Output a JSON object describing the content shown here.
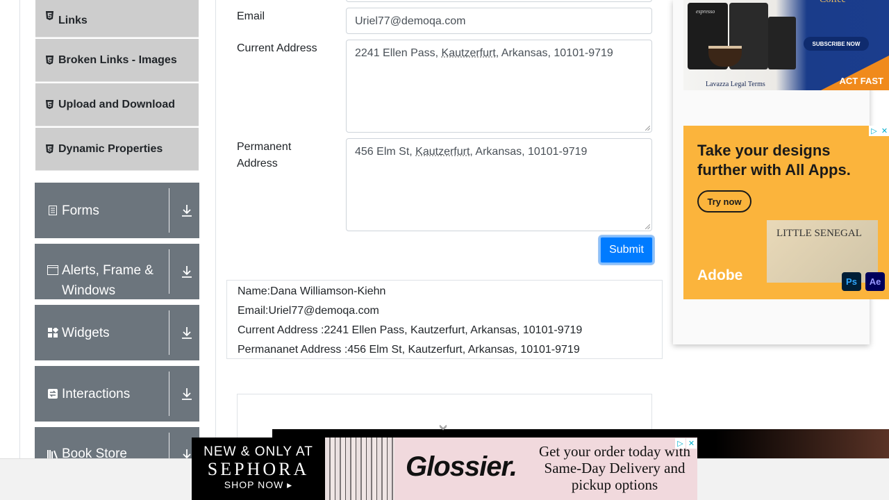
{
  "sidebar": {
    "sub_items": [
      {
        "label": "Links",
        "icon": "html5-icon"
      },
      {
        "label": "Broken Links - Images",
        "icon": "html5-icon"
      },
      {
        "label": "Upload and Download",
        "icon": "html5-icon"
      },
      {
        "label": "Dynamic Properties",
        "icon": "html5-icon"
      }
    ],
    "groups": [
      {
        "label": "Forms",
        "icon": "document-icon"
      },
      {
        "label": "Alerts, Frame & Windows",
        "icon": "window-icon"
      },
      {
        "label": "Widgets",
        "icon": "widgets-icon"
      },
      {
        "label": "Interactions",
        "icon": "interactions-icon"
      },
      {
        "label": "Book Store Application",
        "icon": "book-icon"
      }
    ]
  },
  "form": {
    "email_label": "Email",
    "email_value": "Uriel77@demoqa.com",
    "current_address_label": "Current Address",
    "current_address": {
      "before": "2241 Ellen Pass, ",
      "city": "Kautzerfurt",
      "after": ", Arkansas, 10101-9719"
    },
    "permanent_address_label": "Permanent Address",
    "permanent_address": {
      "before": "456 Elm St, ",
      "city": "Kautzerfurt",
      "after": ", Arkansas, 10101-9719"
    },
    "submit_label": "Submit"
  },
  "output": {
    "name": "Name:Dana Williamson-Kiehn",
    "email": "Email:Uriel77@demoqa.com",
    "current_address": "Current Address :2241 Ellen Pass, Kautzerfurt, Arkansas, 10101-9719",
    "permanent_address": "Permananet Address :456 Elm St, Kautzerfurt, Arkansas, 10101-9719"
  },
  "ads": {
    "coffee": {
      "title": "Coffee",
      "subscribe": "SUBSCRIBE NOW",
      "legal": "Lavazza Legal Terms",
      "cta": "ACT FAST",
      "can_label": "espresso"
    },
    "adobe": {
      "headline": "Take your designs further with All Apps.",
      "cta": "Try now",
      "photo_text": "LITTLE SENEGAL",
      "brand": "Adobe",
      "app1": "Ps",
      "app2": "Ae"
    },
    "bottom": {
      "line1": "NEW & ONLY AT",
      "line2": "SEPHORA",
      "line3": "SHOP NOW ▸",
      "brand": "Glossier.",
      "message": "Get your order today with Same-Day Delivery and pickup options"
    }
  },
  "colors": {
    "accent": "#007bff",
    "sidebar_group": "#6c757d",
    "sidebar_sub": "#cdcdcd"
  }
}
